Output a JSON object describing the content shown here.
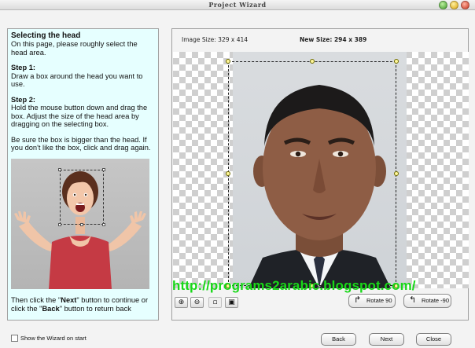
{
  "window": {
    "title": "Project Wizard"
  },
  "instructions": {
    "heading": "Selecting the head",
    "intro": "On this page, please roughly select the head area.",
    "step1_label": "Step 1",
    "step1_text": "Draw a box around the head you want to use.",
    "step2_label": "Step 2",
    "step2_text": "Hold the mouse button down and drag the box. Adjust the size of the head area by dragging on the selecting box.",
    "tip": "Be sure the box is bigger than the head. If you don't like the box, click and drag again.",
    "nav_pre": "Then click the \"",
    "next_word": "Next",
    "nav_mid": "\" button to continue or click the \"",
    "back_word": "Back",
    "nav_post": "\" button to return back"
  },
  "preview": {
    "image_size": "Image Size: 329 x 414",
    "new_size": "New Size: 294 x 389",
    "watermark": "http://programs2arabic.blogspot.com/"
  },
  "toolbar": {
    "rotate_cw": "Rotate 90",
    "rotate_ccw": "Rotate -90"
  },
  "footer": {
    "show_wizard": "Show the Wizard on start",
    "back": "Back",
    "next": "Next",
    "close": "Close"
  }
}
